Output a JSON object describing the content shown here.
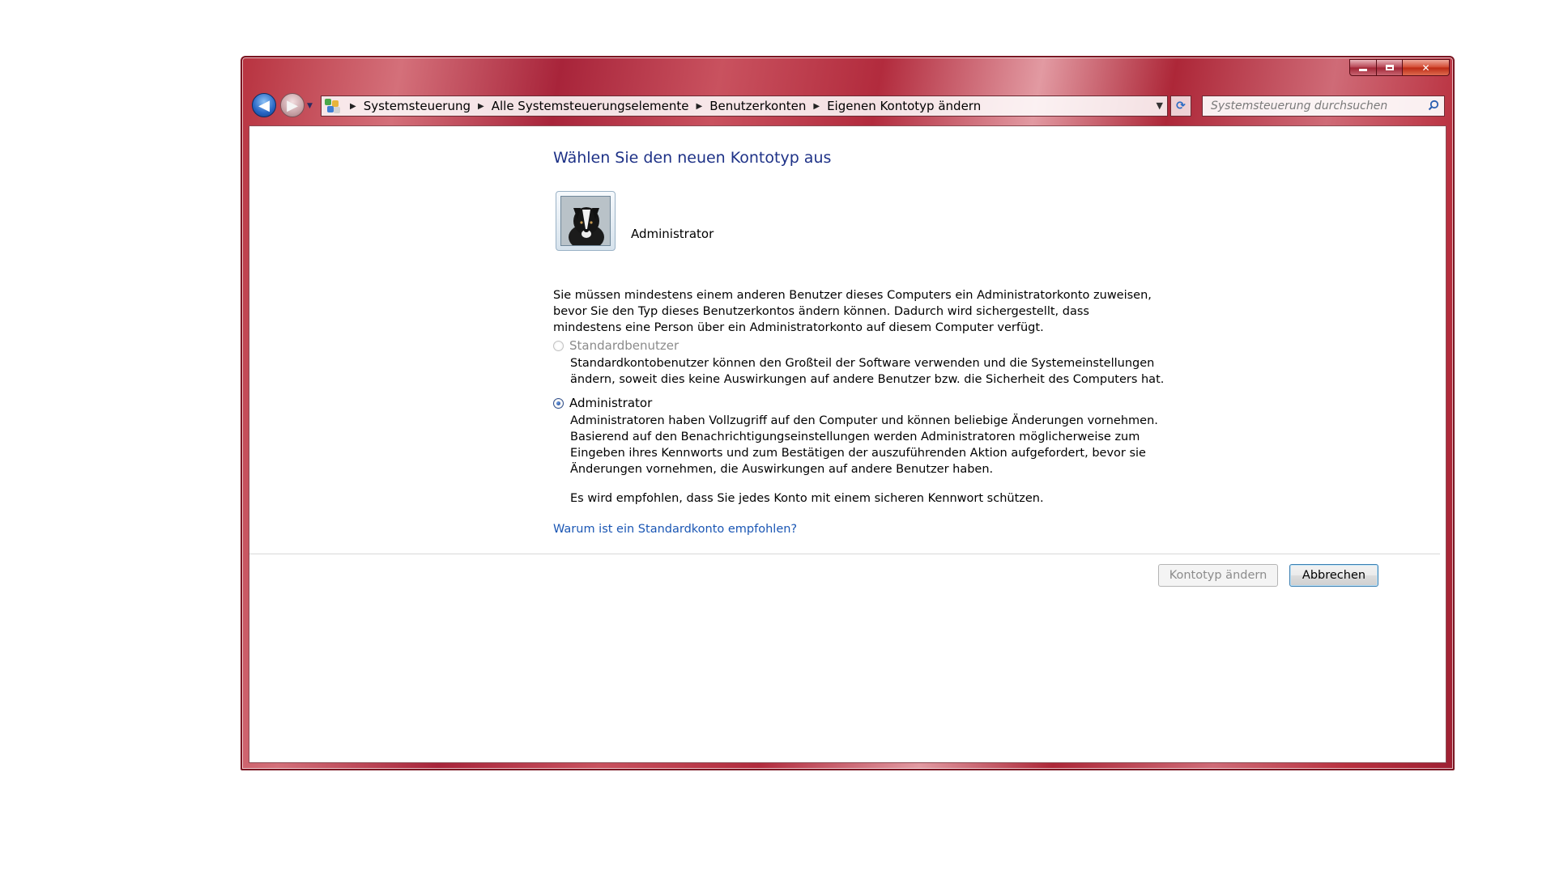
{
  "window": {
    "caption": {
      "minimize": "minimize",
      "maximize": "maximize",
      "close": "close"
    }
  },
  "nav": {
    "back_icon": "arrow-left-icon",
    "forward_icon": "arrow-right-icon"
  },
  "address": {
    "breadcrumbs": [
      "Systemsteuerung",
      "Alle Systemsteuerungselemente",
      "Benutzerkonten",
      "Eigenen Kontotyp ändern"
    ]
  },
  "search": {
    "placeholder": "Systemsteuerung durchsuchen"
  },
  "page": {
    "title": "Wählen Sie den neuen Kontotyp aus",
    "account_name": "Administrator",
    "intro": "Sie müssen mindestens einem anderen Benutzer dieses Computers ein Administratorkonto zuweisen, bevor Sie den Typ dieses Benutzerkontos ändern können. Dadurch wird sichergestellt, dass mindestens eine Person über ein Administratorkonto auf diesem Computer verfügt.",
    "options": [
      {
        "label": "Standardbenutzer",
        "description": "Standardkontobenutzer können den Großteil der Software verwenden und die Systemeinstellungen ändern, soweit dies keine Auswirkungen auf andere Benutzer bzw. die Sicherheit des Computers hat.",
        "checked": false,
        "disabled": true
      },
      {
        "label": "Administrator",
        "description": "Administratoren haben Vollzugriff auf den Computer und können beliebige Änderungen vornehmen. Basierend auf den Benachrichtigungseinstellungen werden Administratoren möglicherweise zum Eingeben ihres Kennworts und zum Bestätigen der auszuführenden Aktion aufgefordert, bevor sie Änderungen vornehmen, die Auswirkungen auf andere Benutzer haben.",
        "checked": true,
        "disabled": false
      }
    ],
    "recommendation": "Es wird empfohlen, dass Sie jedes Konto mit einem sicheren Kennwort schützen.",
    "help_link": "Warum ist ein Standardkonto empfohlen?",
    "buttons": {
      "change": "Kontotyp ändern",
      "cancel": "Abbrechen"
    }
  },
  "colors": {
    "title_blue": "#1e3287",
    "link_blue": "#1a56b4",
    "frame_red": "#b22b3d"
  }
}
